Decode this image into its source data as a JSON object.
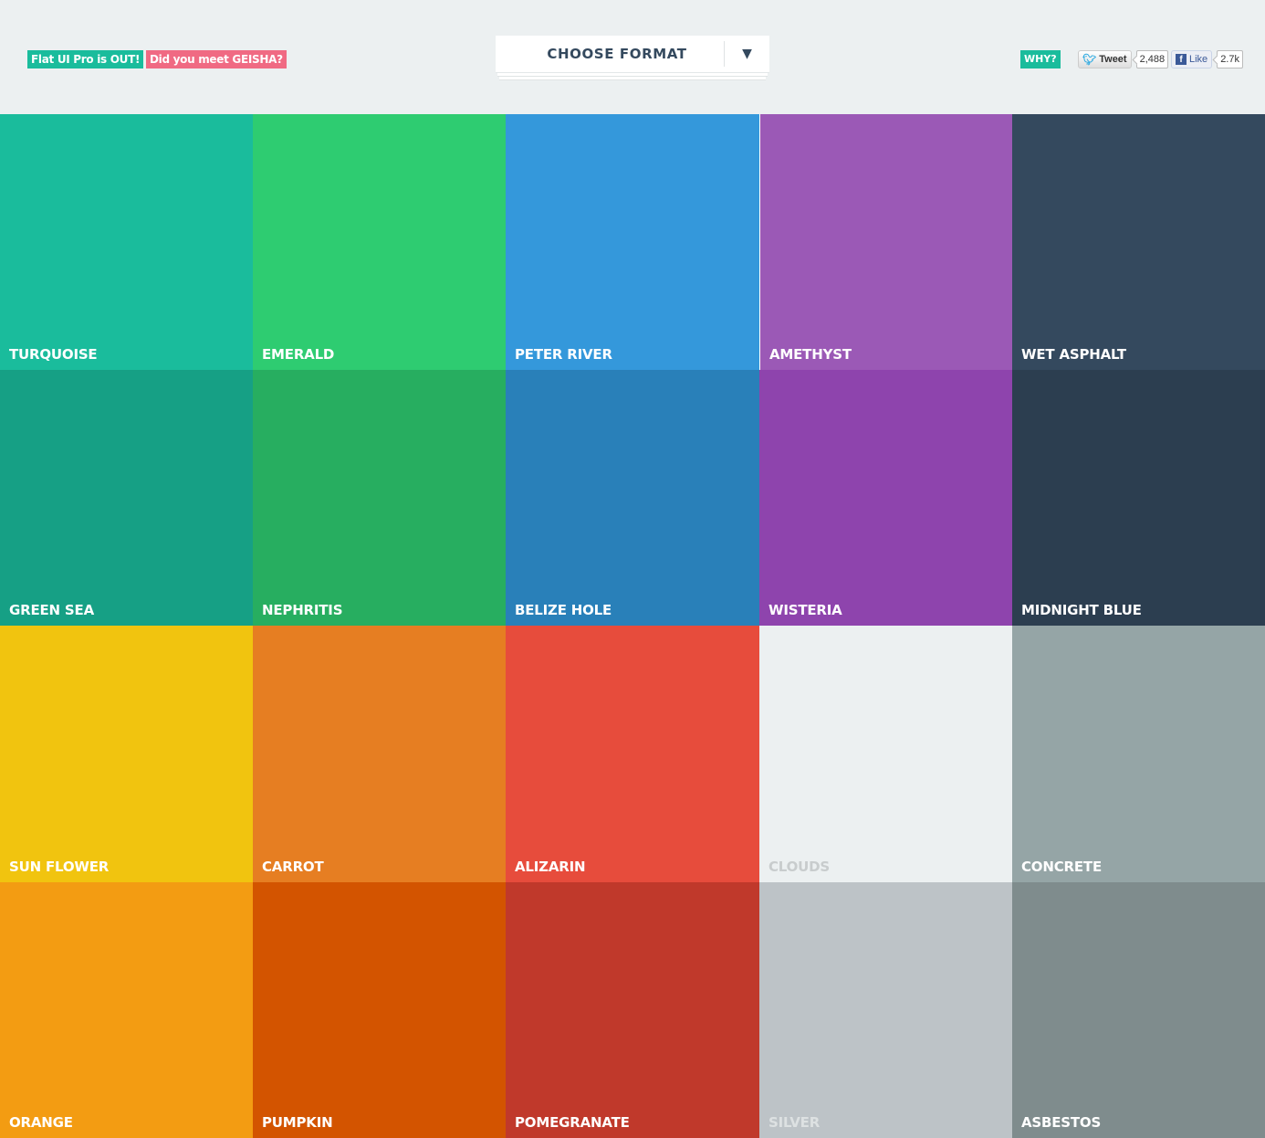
{
  "header": {
    "promo_flat_ui": {
      "label": "Flat UI Pro is OUT!",
      "color": "#1abc9c"
    },
    "promo_geisha": {
      "label": "Did you meet GEISHA?",
      "color": "#f06a83"
    },
    "format_dropdown": {
      "label": "CHOOSE FORMAT",
      "caret": "▼"
    },
    "why": {
      "label": "WHY?"
    },
    "tweet": {
      "icon": "twitter-bird-icon",
      "label": "Tweet",
      "count": "2,488"
    },
    "like": {
      "icon": "facebook-icon",
      "label": "Like",
      "count": "2.7k"
    }
  },
  "colors": [
    {
      "name": "TURQUOISE",
      "hex": "#1abc9c"
    },
    {
      "name": "EMERALD",
      "hex": "#2ecc71"
    },
    {
      "name": "PETER RIVER",
      "hex": "#3498db"
    },
    {
      "name": "AMETHYST",
      "hex": "#9b59b6"
    },
    {
      "name": "WET ASPHALT",
      "hex": "#34495e"
    },
    {
      "name": "GREEN SEA",
      "hex": "#16a085"
    },
    {
      "name": "NEPHRITIS",
      "hex": "#27ae60"
    },
    {
      "name": "BELIZE HOLE",
      "hex": "#2980b9"
    },
    {
      "name": "WISTERIA",
      "hex": "#8e44ad"
    },
    {
      "name": "MIDNIGHT BLUE",
      "hex": "#2c3e50"
    },
    {
      "name": "SUN FLOWER",
      "hex": "#f1c40f"
    },
    {
      "name": "CARROT",
      "hex": "#e67e22"
    },
    {
      "name": "ALIZARIN",
      "hex": "#e74c3c"
    },
    {
      "name": "CLOUDS",
      "hex": "#ecf0f1"
    },
    {
      "name": "CONCRETE",
      "hex": "#95a5a6"
    },
    {
      "name": "ORANGE",
      "hex": "#f39c12"
    },
    {
      "name": "PUMPKIN",
      "hex": "#d35400"
    },
    {
      "name": "POMEGRANATE",
      "hex": "#c0392b"
    },
    {
      "name": "SILVER",
      "hex": "#bdc3c7"
    },
    {
      "name": "ASBESTOS",
      "hex": "#7f8c8d"
    }
  ]
}
